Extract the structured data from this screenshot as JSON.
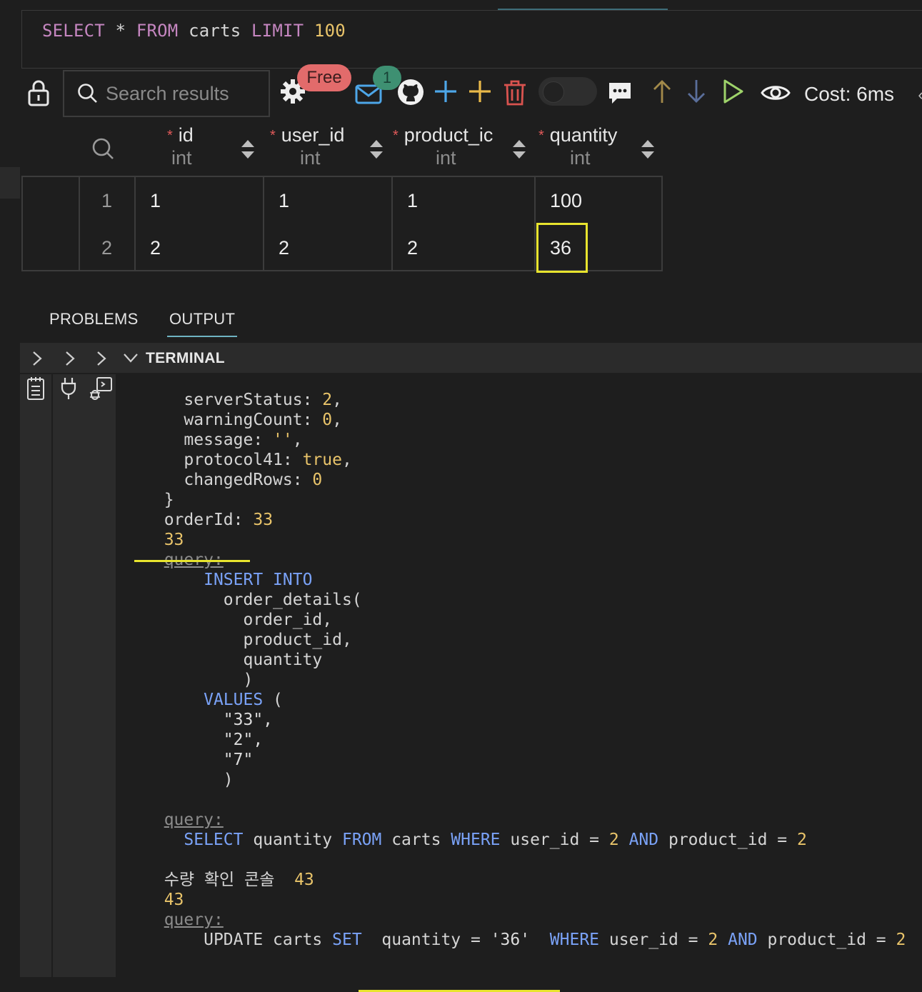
{
  "editor": {
    "sql_select": "SELECT",
    "sql_star": " * ",
    "sql_from": "FROM",
    "sql_table": " carts ",
    "sql_limit": "LIMIT",
    "sql_limit_value": " 100"
  },
  "toolbar": {
    "search_placeholder": "Search results",
    "free_badge": "Free",
    "notification_count": "1",
    "cost": "Cost: 6ms"
  },
  "grid": {
    "columns": [
      {
        "name": "id",
        "type": "int",
        "required_mark": "*"
      },
      {
        "name": "user_id",
        "type": "int",
        "required_mark": "*"
      },
      {
        "name": "product_ic",
        "type": "int",
        "required_mark": "*"
      },
      {
        "name": "quantity",
        "type": "int",
        "required_mark": "*"
      }
    ],
    "rows": [
      {
        "row_number": "1",
        "id": "1",
        "user_id": "1",
        "product_id": "1",
        "quantity": "100"
      },
      {
        "row_number": "2",
        "id": "2",
        "user_id": "2",
        "product_id": "2",
        "quantity": "36"
      }
    ],
    "highlight_color": "#e8e42e"
  },
  "panel": {
    "tabs": [
      "PROBLEMS",
      "OUTPUT"
    ],
    "active_tab": "OUTPUT",
    "terminal_title": "TERMINAL"
  },
  "terminal": {
    "server_status_key": "serverStatus",
    "server_status_value": "2",
    "warning_count_key": "warningCount",
    "warning_count_value": "0",
    "message_key": "message",
    "message_value": "''",
    "protocol_key": "protocol41",
    "protocol_value": "true",
    "changed_rows_key": "changedRows",
    "changed_rows_value": "0",
    "close_brace": "}",
    "order_id_key": "orderId:",
    "order_id_value": "33",
    "order_id_echo": "33",
    "query_label": "query:",
    "insert_kw": "INSERT INTO",
    "insert_table": "order_details(",
    "insert_cols": [
      "order_id,",
      "product_id,",
      "quantity"
    ],
    "insert_close": ")",
    "values_kw": "VALUES",
    "values_open": " (",
    "values": [
      "\"33\",",
      "\"2\",",
      "\"7\""
    ],
    "values_close": ")",
    "select_query": {
      "select": "SELECT",
      "col": " quantity ",
      "from": "FROM",
      "table": " carts ",
      "where": "WHERE",
      "cond1": " user_id = ",
      "v1": "2",
      "and": " AND",
      "cond2": " product_id = ",
      "v2": "2"
    },
    "korean_label": "수량 확인 콘솔",
    "korean_value": "43",
    "korean_echo": "43",
    "update_query": {
      "update": "UPDATE carts",
      "set": "SET",
      "assign": "quantity = ",
      "val": "'36'",
      "where": "WHERE",
      "cond1": " user_id = ",
      "v1": "2",
      "and": "AND",
      "cond2": " product_id = ",
      "v2": "2"
    }
  },
  "colors": {
    "accent_underline": "#e8e42e",
    "keyword_blue": "#7aa2f7",
    "keyword_purple": "#c586c0",
    "number_yellow": "#e9c46a",
    "free_badge_bg": "#e26b6b",
    "count_badge_bg": "#3e9072"
  },
  "icons": [
    "lock-icon",
    "search-icon",
    "gear-icon",
    "mail-icon",
    "github-icon",
    "add-icon",
    "add-row-icon",
    "trash-icon",
    "toggle",
    "comment-icon",
    "arrow-up-icon",
    "arrow-down-icon",
    "play-icon",
    "eye-icon",
    "chevron-right-icon",
    "chevron-down-icon",
    "notes-icon",
    "plug-icon",
    "debug-console-icon",
    "sort-icon"
  ]
}
